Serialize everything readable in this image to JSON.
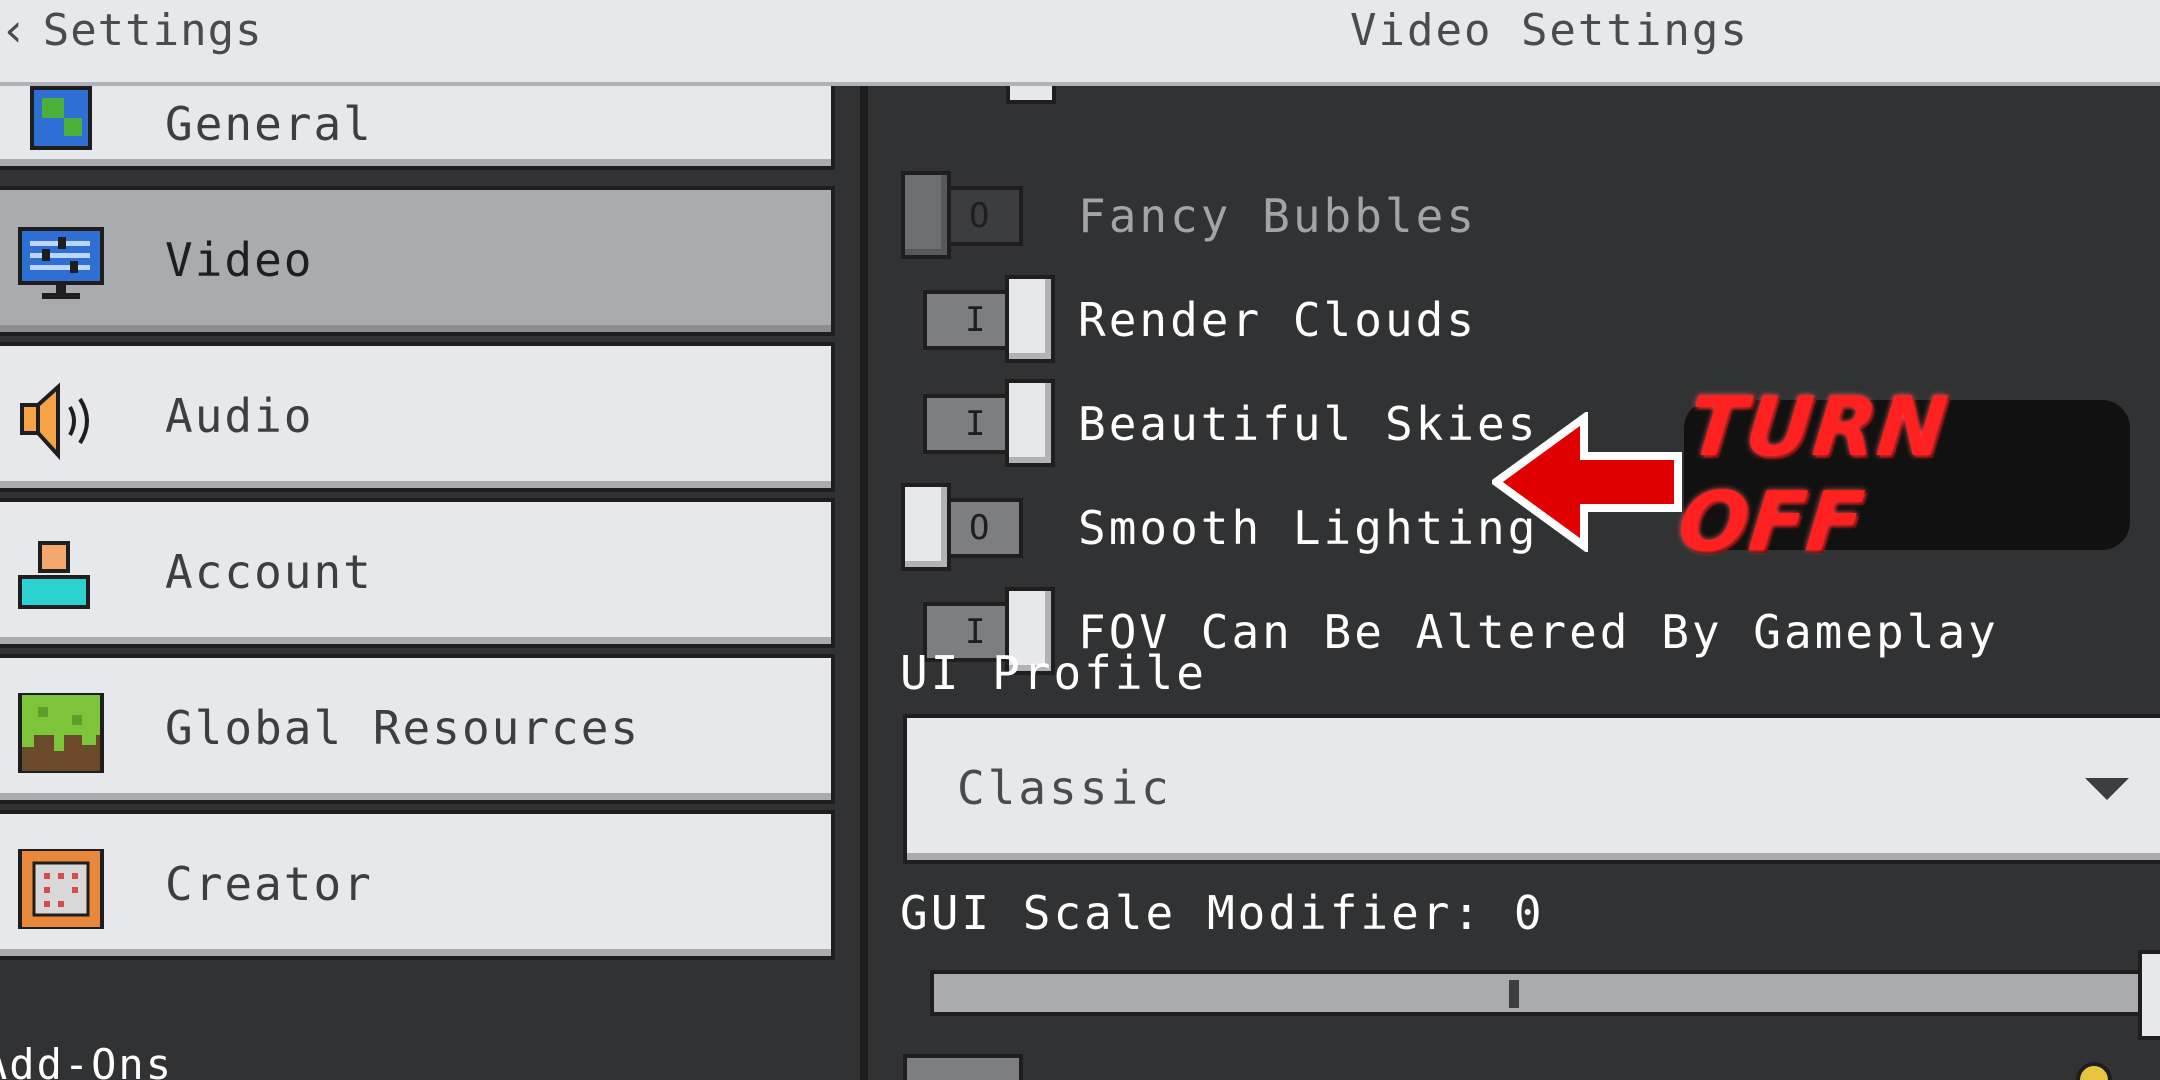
{
  "header": {
    "back_label": "Settings",
    "title": "Video Settings"
  },
  "sidebar": {
    "items": [
      {
        "label": "General",
        "icon": "globe-icon"
      },
      {
        "label": "Video",
        "icon": "monitor-icon",
        "selected": true
      },
      {
        "label": "Audio",
        "icon": "speaker-icon"
      },
      {
        "label": "Account",
        "icon": "account-icon"
      },
      {
        "label": "Global Resources",
        "icon": "grass-block-icon"
      },
      {
        "label": "Creator",
        "icon": "command-block-icon"
      }
    ],
    "addons_heading": "Add-Ons"
  },
  "video": {
    "toggles": [
      {
        "label": "Fancy Bubbles",
        "on": false,
        "enabled": false
      },
      {
        "label": "Render Clouds",
        "on": true,
        "enabled": true
      },
      {
        "label": "Beautiful Skies",
        "on": true,
        "enabled": true
      },
      {
        "label": "Smooth Lighting",
        "on": false,
        "enabled": true
      },
      {
        "label": "FOV Can Be Altered By Gameplay",
        "on": true,
        "enabled": true
      }
    ],
    "ui_profile_label": "UI Profile",
    "ui_profile_value": "Classic",
    "gui_scale_label": "GUI Scale Modifier: 0",
    "gui_scale_value": 0
  },
  "annotation": {
    "text": "TURN OFF",
    "color": "#ff2020"
  },
  "colors": {
    "panel_light": "#e6e8eb",
    "panel_selected": "#a9abae",
    "background_dark": "#313233",
    "border": "#1e1e1f",
    "accent_red": "#ff2020"
  }
}
